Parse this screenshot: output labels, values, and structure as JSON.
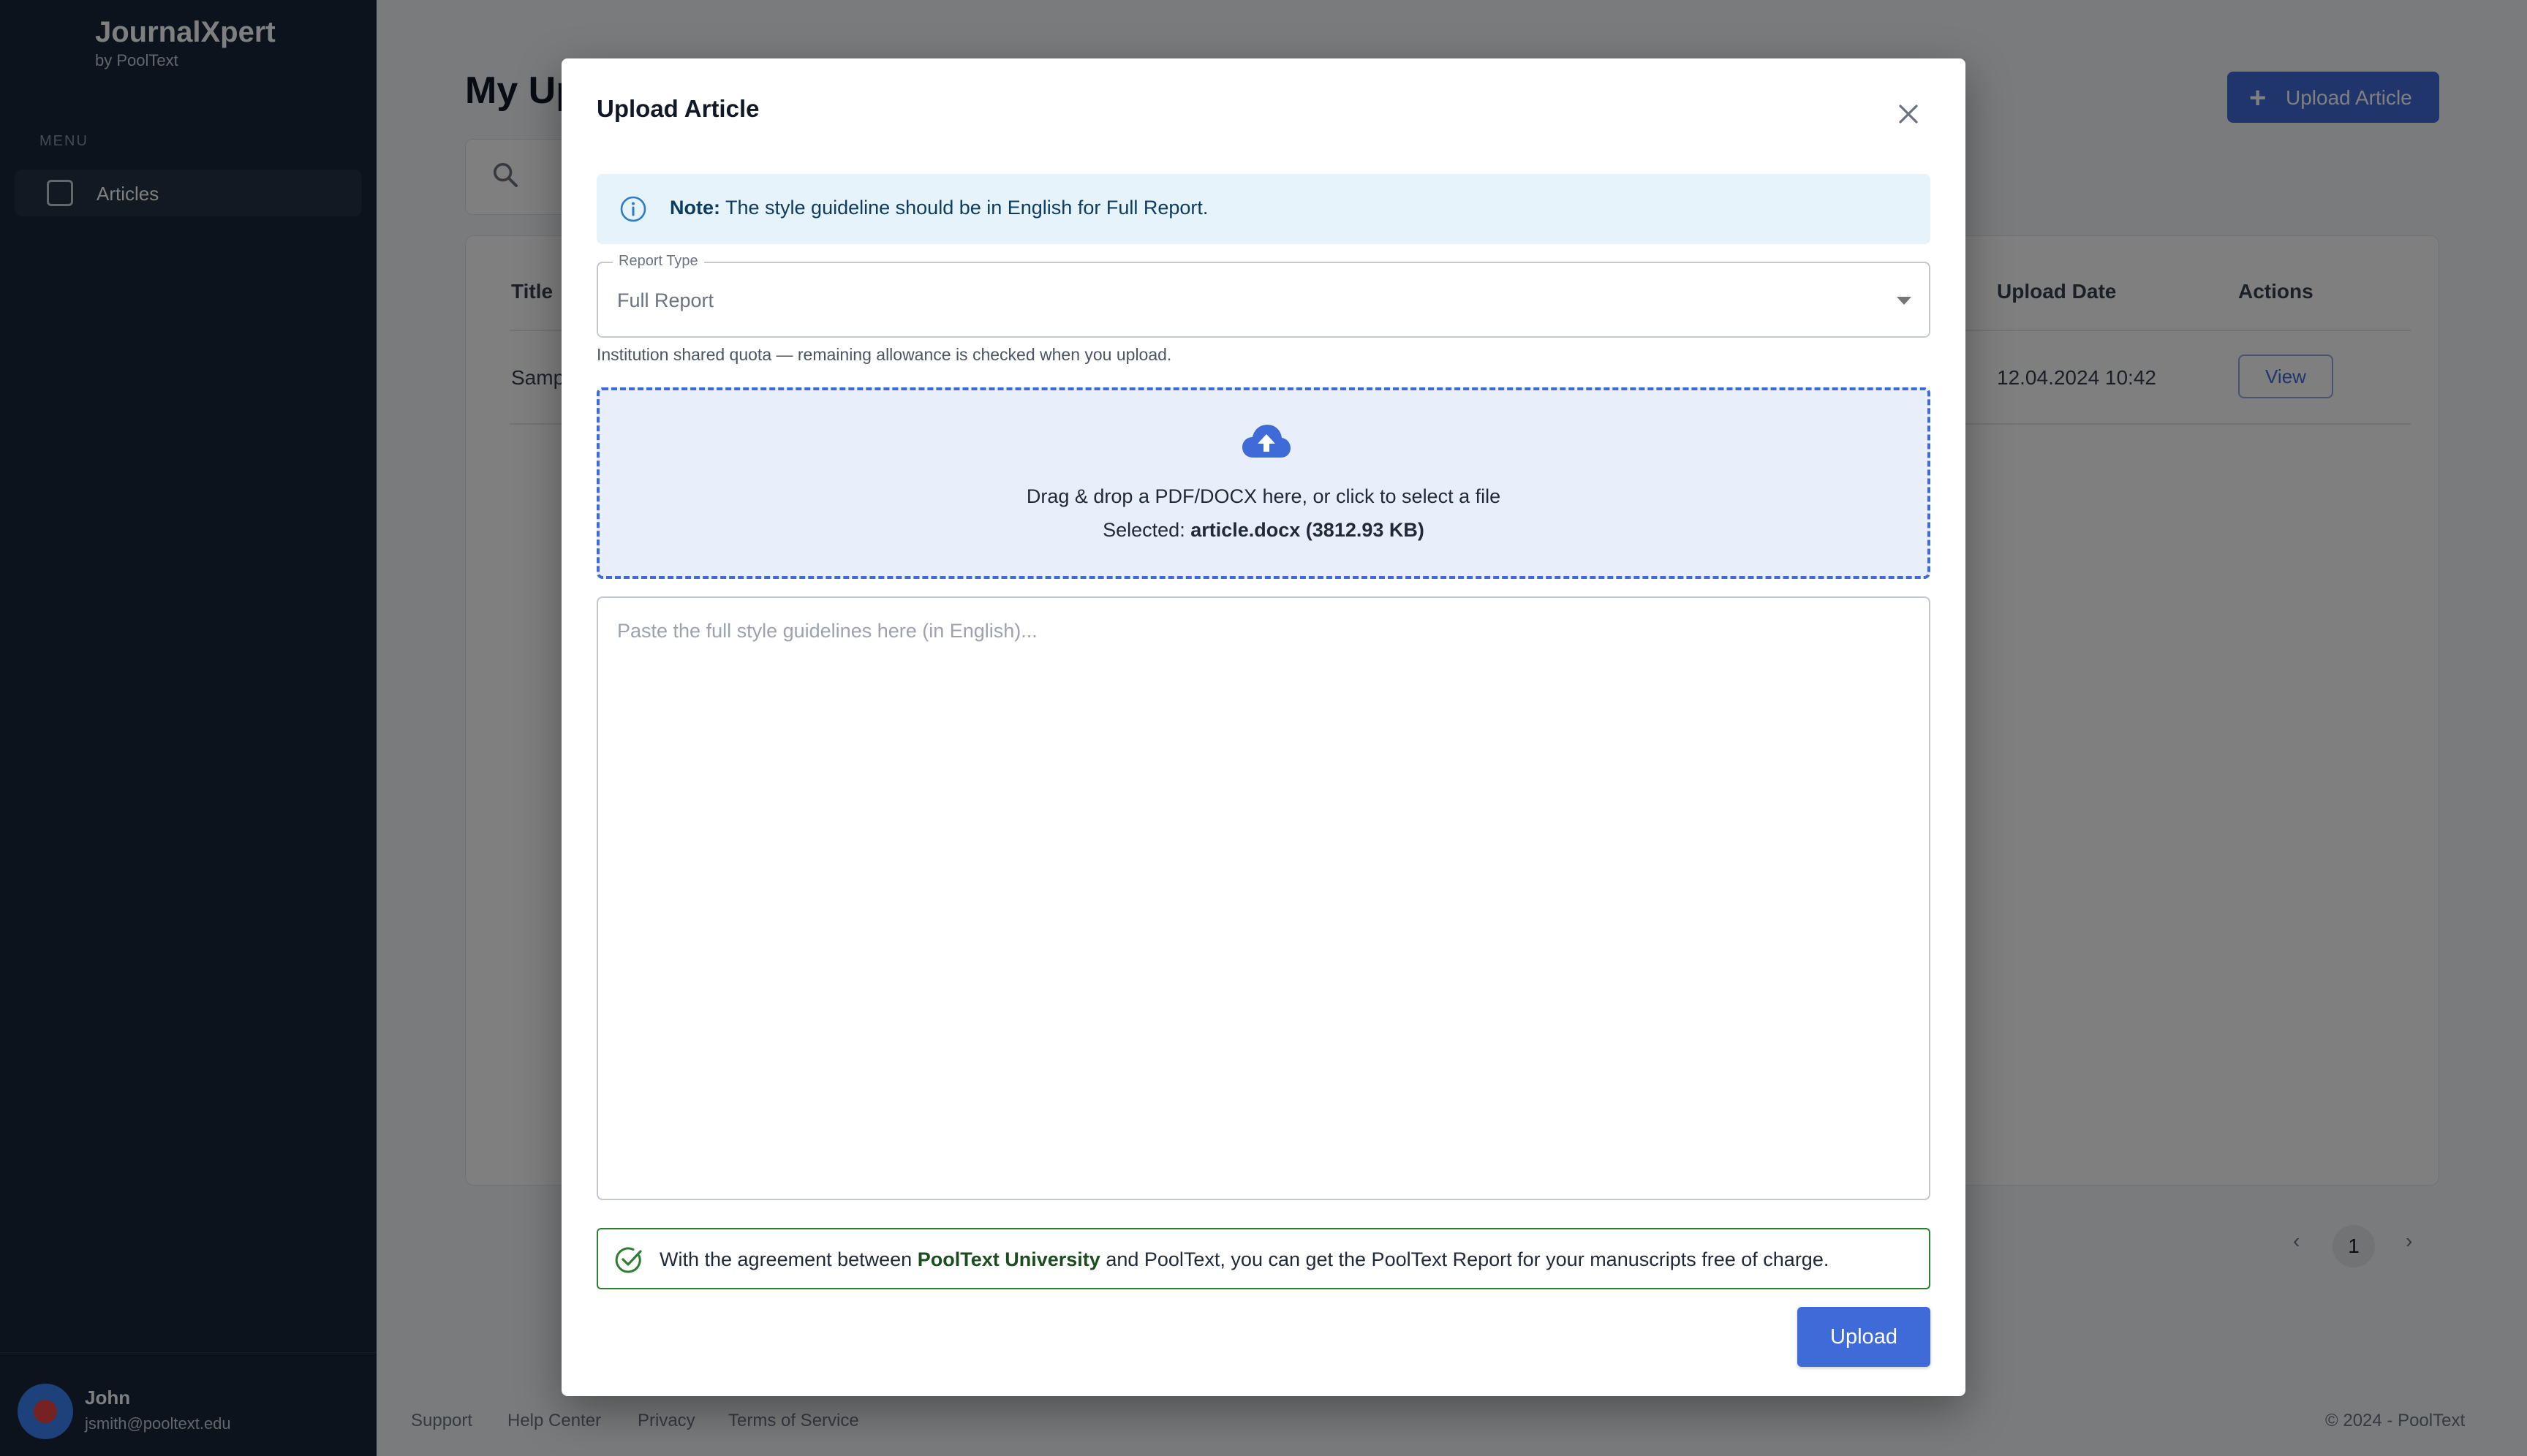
{
  "sidebar": {
    "brand": "JournalXpert",
    "brand_sub": "by PoolText",
    "section": "MENU",
    "items": [
      {
        "label": "Articles",
        "icon": "document-icon"
      }
    ],
    "user": {
      "name": "John",
      "email": "jsmith@pooltext.edu"
    }
  },
  "main": {
    "title": "My Uploads",
    "upload_button": "Upload Article",
    "search_icon": "search-icon",
    "table": {
      "headers": [
        "Title",
        "Upload Date",
        "Actions"
      ],
      "rows": [
        {
          "title": "Sample",
          "upload_date": "12.04.2024 10:42",
          "action": "View"
        }
      ]
    },
    "pagination": {
      "prev": "‹",
      "current": "1",
      "next": "›"
    },
    "footer": {
      "links": [
        "Support",
        "Help Center",
        "Privacy",
        "Terms of Service"
      ],
      "copyright": "© 2024 - PoolText"
    }
  },
  "modal": {
    "title": "Upload Article",
    "close_icon": "close-icon",
    "note": {
      "icon": "info-icon",
      "label": "Note:",
      "text": "The style guideline should be in English for Full Report."
    },
    "report_type": {
      "label": "Report Type",
      "value": "Full Report"
    },
    "quota_text": "Institution shared quota — remaining allowance is checked when you upload.",
    "dropzone": {
      "icon": "cloud-upload-icon",
      "text": "Drag & drop a PDF/DOCX here, or click to select a file",
      "selected_label": "Selected:",
      "selected_file": "article.docx (3812.93 KB)"
    },
    "guidelines": {
      "placeholder": "Paste the full style guidelines here (in English)...",
      "value": ""
    },
    "agreement": {
      "icon": "check-circle-icon",
      "prefix": "With the agreement between",
      "institution": "PoolText University",
      "suffix": "and PoolText, you can get the PoolText Report for your manuscripts free of charge."
    },
    "upload_button": "Upload"
  },
  "colors": {
    "accent": "#3f6bd9",
    "sidebar": "#1b2638",
    "note_bg": "#e6f3fb",
    "success": "#2e7d32"
  }
}
